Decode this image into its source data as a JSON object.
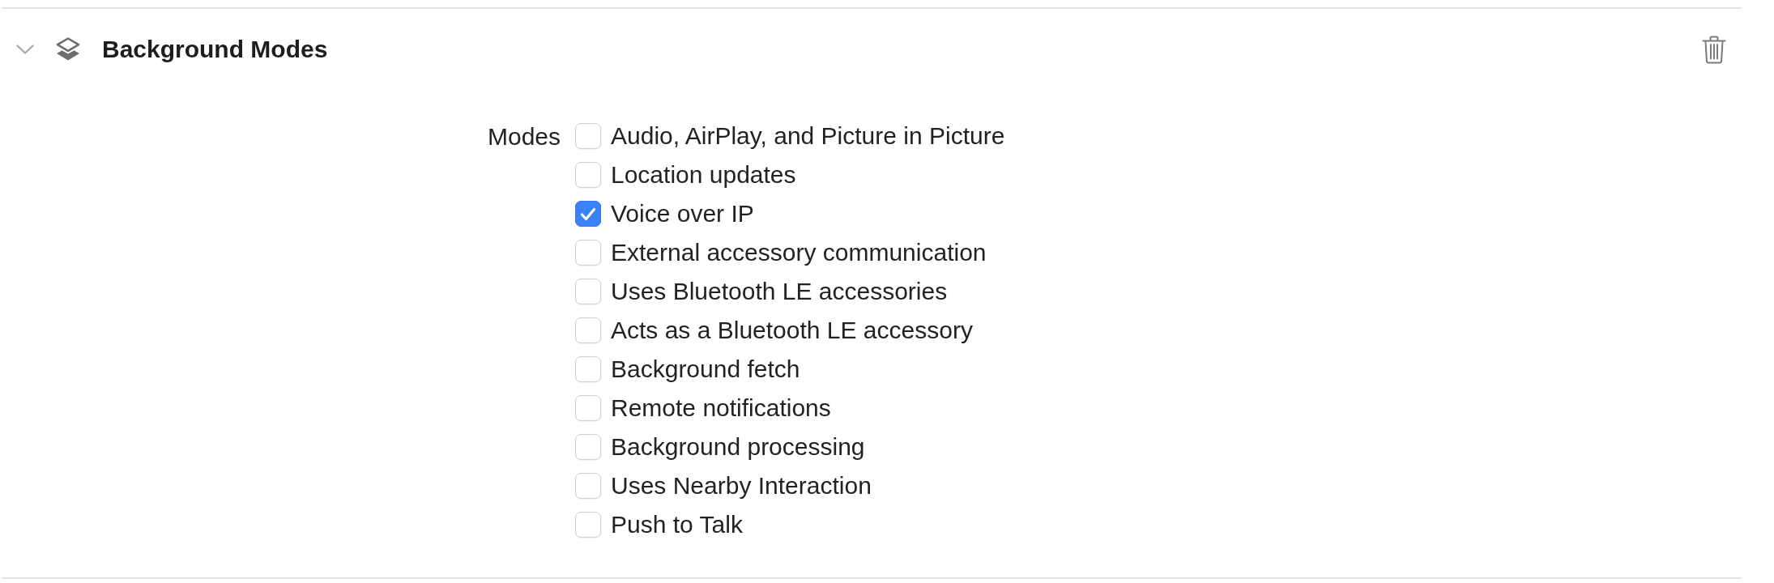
{
  "section": {
    "title": "Background Modes",
    "expanded": true
  },
  "modes": {
    "label": "Modes",
    "options": [
      {
        "label": "Audio, AirPlay, and Picture in Picture",
        "checked": false
      },
      {
        "label": "Location updates",
        "checked": false
      },
      {
        "label": "Voice over IP",
        "checked": true
      },
      {
        "label": "External accessory communication",
        "checked": false
      },
      {
        "label": "Uses Bluetooth LE accessories",
        "checked": false
      },
      {
        "label": "Acts as a Bluetooth LE accessory",
        "checked": false
      },
      {
        "label": "Background fetch",
        "checked": false
      },
      {
        "label": "Remote notifications",
        "checked": false
      },
      {
        "label": "Background processing",
        "checked": false
      },
      {
        "label": "Uses Nearby Interaction",
        "checked": false
      },
      {
        "label": "Push to Talk",
        "checked": false
      }
    ]
  }
}
